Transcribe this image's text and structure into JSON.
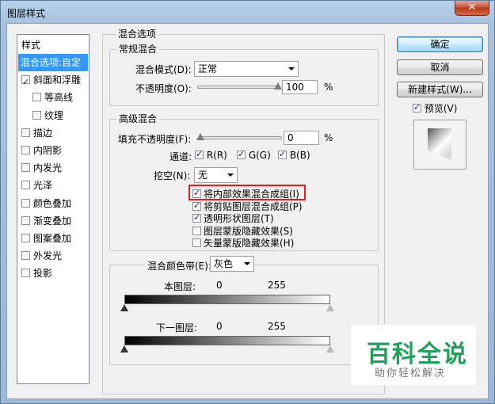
{
  "window": {
    "title": "图层样式",
    "close_glyph": "✕"
  },
  "style_panel": {
    "header": "样式",
    "items": [
      {
        "label": "混合选项:自定",
        "checkbox": false,
        "checked": false,
        "selected": true
      },
      {
        "label": "斜面和浮雕",
        "checkbox": true,
        "checked": true,
        "selected": false
      },
      {
        "label": "等高线",
        "checkbox": true,
        "checked": false,
        "selected": false
      },
      {
        "label": "纹理",
        "checkbox": true,
        "checked": false,
        "selected": false
      },
      {
        "label": "描边",
        "checkbox": true,
        "checked": false,
        "selected": false
      },
      {
        "label": "内阴影",
        "checkbox": true,
        "checked": false,
        "selected": false
      },
      {
        "label": "内发光",
        "checkbox": true,
        "checked": false,
        "selected": false
      },
      {
        "label": "光泽",
        "checkbox": true,
        "checked": false,
        "selected": false
      },
      {
        "label": "颜色叠加",
        "checkbox": true,
        "checked": false,
        "selected": false
      },
      {
        "label": "渐变叠加",
        "checkbox": true,
        "checked": false,
        "selected": false
      },
      {
        "label": "图案叠加",
        "checkbox": true,
        "checked": false,
        "selected": false
      },
      {
        "label": "外发光",
        "checkbox": true,
        "checked": false,
        "selected": false
      },
      {
        "label": "投影",
        "checkbox": true,
        "checked": false,
        "selected": false
      }
    ]
  },
  "blend_options": {
    "title": "混合选项",
    "general": {
      "title": "常规混合",
      "mode_label": "混合模式(D):",
      "mode_value": "正常",
      "opacity_label": "不透明度(O):",
      "opacity_value": "100",
      "opacity_unit": "%"
    },
    "advanced": {
      "title": "高级混合",
      "fill_label": "填充不透明度(F):",
      "fill_value": "0",
      "fill_unit": "%",
      "channels_label": "通道:",
      "channels": [
        {
          "label": "R(R)",
          "checked": true
        },
        {
          "label": "G(G)",
          "checked": true
        },
        {
          "label": "B(B)",
          "checked": true
        }
      ],
      "knockout_label": "挖空(N):",
      "knockout_value": "无",
      "options": [
        {
          "label": "将内部效果混合成组(I)",
          "checked": true
        },
        {
          "label": "将剪贴图层混合成组(P)",
          "checked": true
        },
        {
          "label": "透明形状图层(T)",
          "checked": true
        },
        {
          "label": "图层蒙版隐藏效果(S)",
          "checked": false
        },
        {
          "label": "矢量蒙版隐藏效果(H)",
          "checked": false
        }
      ]
    },
    "blend_if": {
      "label": "混合颜色带(E):",
      "value": "灰色",
      "this_layer_label": "本图层:",
      "this_layer_min": "0",
      "this_layer_max": "255",
      "underlying_label": "下一图层:",
      "underlying_min": "0",
      "underlying_max": "255"
    }
  },
  "buttons": {
    "ok": "确定",
    "cancel": "取消",
    "new_style": "新建样式(W)...",
    "preview_label": "预览(V)",
    "preview_checked": true
  },
  "watermark": {
    "title": "百科全说",
    "subtitle": "助你轻松解决"
  },
  "colors": {
    "selected": "#3399ff",
    "highlight": "#e02020",
    "watermark": "#1ea158"
  }
}
